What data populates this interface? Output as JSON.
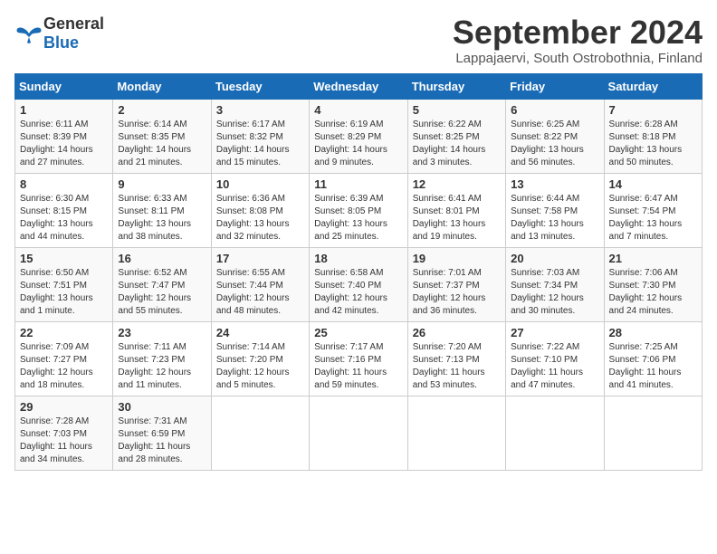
{
  "header": {
    "logo_general": "General",
    "logo_blue": "Blue",
    "title": "September 2024",
    "subtitle": "Lappajaervi, South Ostrobothnia, Finland"
  },
  "days_of_week": [
    "Sunday",
    "Monday",
    "Tuesday",
    "Wednesday",
    "Thursday",
    "Friday",
    "Saturday"
  ],
  "weeks": [
    [
      {
        "day": "1",
        "sunrise": "Sunrise: 6:11 AM",
        "sunset": "Sunset: 8:39 PM",
        "daylight": "Daylight: 14 hours and 27 minutes."
      },
      {
        "day": "2",
        "sunrise": "Sunrise: 6:14 AM",
        "sunset": "Sunset: 8:35 PM",
        "daylight": "Daylight: 14 hours and 21 minutes."
      },
      {
        "day": "3",
        "sunrise": "Sunrise: 6:17 AM",
        "sunset": "Sunset: 8:32 PM",
        "daylight": "Daylight: 14 hours and 15 minutes."
      },
      {
        "day": "4",
        "sunrise": "Sunrise: 6:19 AM",
        "sunset": "Sunset: 8:29 PM",
        "daylight": "Daylight: 14 hours and 9 minutes."
      },
      {
        "day": "5",
        "sunrise": "Sunrise: 6:22 AM",
        "sunset": "Sunset: 8:25 PM",
        "daylight": "Daylight: 14 hours and 3 minutes."
      },
      {
        "day": "6",
        "sunrise": "Sunrise: 6:25 AM",
        "sunset": "Sunset: 8:22 PM",
        "daylight": "Daylight: 13 hours and 56 minutes."
      },
      {
        "day": "7",
        "sunrise": "Sunrise: 6:28 AM",
        "sunset": "Sunset: 8:18 PM",
        "daylight": "Daylight: 13 hours and 50 minutes."
      }
    ],
    [
      {
        "day": "8",
        "sunrise": "Sunrise: 6:30 AM",
        "sunset": "Sunset: 8:15 PM",
        "daylight": "Daylight: 13 hours and 44 minutes."
      },
      {
        "day": "9",
        "sunrise": "Sunrise: 6:33 AM",
        "sunset": "Sunset: 8:11 PM",
        "daylight": "Daylight: 13 hours and 38 minutes."
      },
      {
        "day": "10",
        "sunrise": "Sunrise: 6:36 AM",
        "sunset": "Sunset: 8:08 PM",
        "daylight": "Daylight: 13 hours and 32 minutes."
      },
      {
        "day": "11",
        "sunrise": "Sunrise: 6:39 AM",
        "sunset": "Sunset: 8:05 PM",
        "daylight": "Daylight: 13 hours and 25 minutes."
      },
      {
        "day": "12",
        "sunrise": "Sunrise: 6:41 AM",
        "sunset": "Sunset: 8:01 PM",
        "daylight": "Daylight: 13 hours and 19 minutes."
      },
      {
        "day": "13",
        "sunrise": "Sunrise: 6:44 AM",
        "sunset": "Sunset: 7:58 PM",
        "daylight": "Daylight: 13 hours and 13 minutes."
      },
      {
        "day": "14",
        "sunrise": "Sunrise: 6:47 AM",
        "sunset": "Sunset: 7:54 PM",
        "daylight": "Daylight: 13 hours and 7 minutes."
      }
    ],
    [
      {
        "day": "15",
        "sunrise": "Sunrise: 6:50 AM",
        "sunset": "Sunset: 7:51 PM",
        "daylight": "Daylight: 13 hours and 1 minute."
      },
      {
        "day": "16",
        "sunrise": "Sunrise: 6:52 AM",
        "sunset": "Sunset: 7:47 PM",
        "daylight": "Daylight: 12 hours and 55 minutes."
      },
      {
        "day": "17",
        "sunrise": "Sunrise: 6:55 AM",
        "sunset": "Sunset: 7:44 PM",
        "daylight": "Daylight: 12 hours and 48 minutes."
      },
      {
        "day": "18",
        "sunrise": "Sunrise: 6:58 AM",
        "sunset": "Sunset: 7:40 PM",
        "daylight": "Daylight: 12 hours and 42 minutes."
      },
      {
        "day": "19",
        "sunrise": "Sunrise: 7:01 AM",
        "sunset": "Sunset: 7:37 PM",
        "daylight": "Daylight: 12 hours and 36 minutes."
      },
      {
        "day": "20",
        "sunrise": "Sunrise: 7:03 AM",
        "sunset": "Sunset: 7:34 PM",
        "daylight": "Daylight: 12 hours and 30 minutes."
      },
      {
        "day": "21",
        "sunrise": "Sunrise: 7:06 AM",
        "sunset": "Sunset: 7:30 PM",
        "daylight": "Daylight: 12 hours and 24 minutes."
      }
    ],
    [
      {
        "day": "22",
        "sunrise": "Sunrise: 7:09 AM",
        "sunset": "Sunset: 7:27 PM",
        "daylight": "Daylight: 12 hours and 18 minutes."
      },
      {
        "day": "23",
        "sunrise": "Sunrise: 7:11 AM",
        "sunset": "Sunset: 7:23 PM",
        "daylight": "Daylight: 12 hours and 11 minutes."
      },
      {
        "day": "24",
        "sunrise": "Sunrise: 7:14 AM",
        "sunset": "Sunset: 7:20 PM",
        "daylight": "Daylight: 12 hours and 5 minutes."
      },
      {
        "day": "25",
        "sunrise": "Sunrise: 7:17 AM",
        "sunset": "Sunset: 7:16 PM",
        "daylight": "Daylight: 11 hours and 59 minutes."
      },
      {
        "day": "26",
        "sunrise": "Sunrise: 7:20 AM",
        "sunset": "Sunset: 7:13 PM",
        "daylight": "Daylight: 11 hours and 53 minutes."
      },
      {
        "day": "27",
        "sunrise": "Sunrise: 7:22 AM",
        "sunset": "Sunset: 7:10 PM",
        "daylight": "Daylight: 11 hours and 47 minutes."
      },
      {
        "day": "28",
        "sunrise": "Sunrise: 7:25 AM",
        "sunset": "Sunset: 7:06 PM",
        "daylight": "Daylight: 11 hours and 41 minutes."
      }
    ],
    [
      {
        "day": "29",
        "sunrise": "Sunrise: 7:28 AM",
        "sunset": "Sunset: 7:03 PM",
        "daylight": "Daylight: 11 hours and 34 minutes."
      },
      {
        "day": "30",
        "sunrise": "Sunrise: 7:31 AM",
        "sunset": "Sunset: 6:59 PM",
        "daylight": "Daylight: 11 hours and 28 minutes."
      },
      null,
      null,
      null,
      null,
      null
    ]
  ]
}
